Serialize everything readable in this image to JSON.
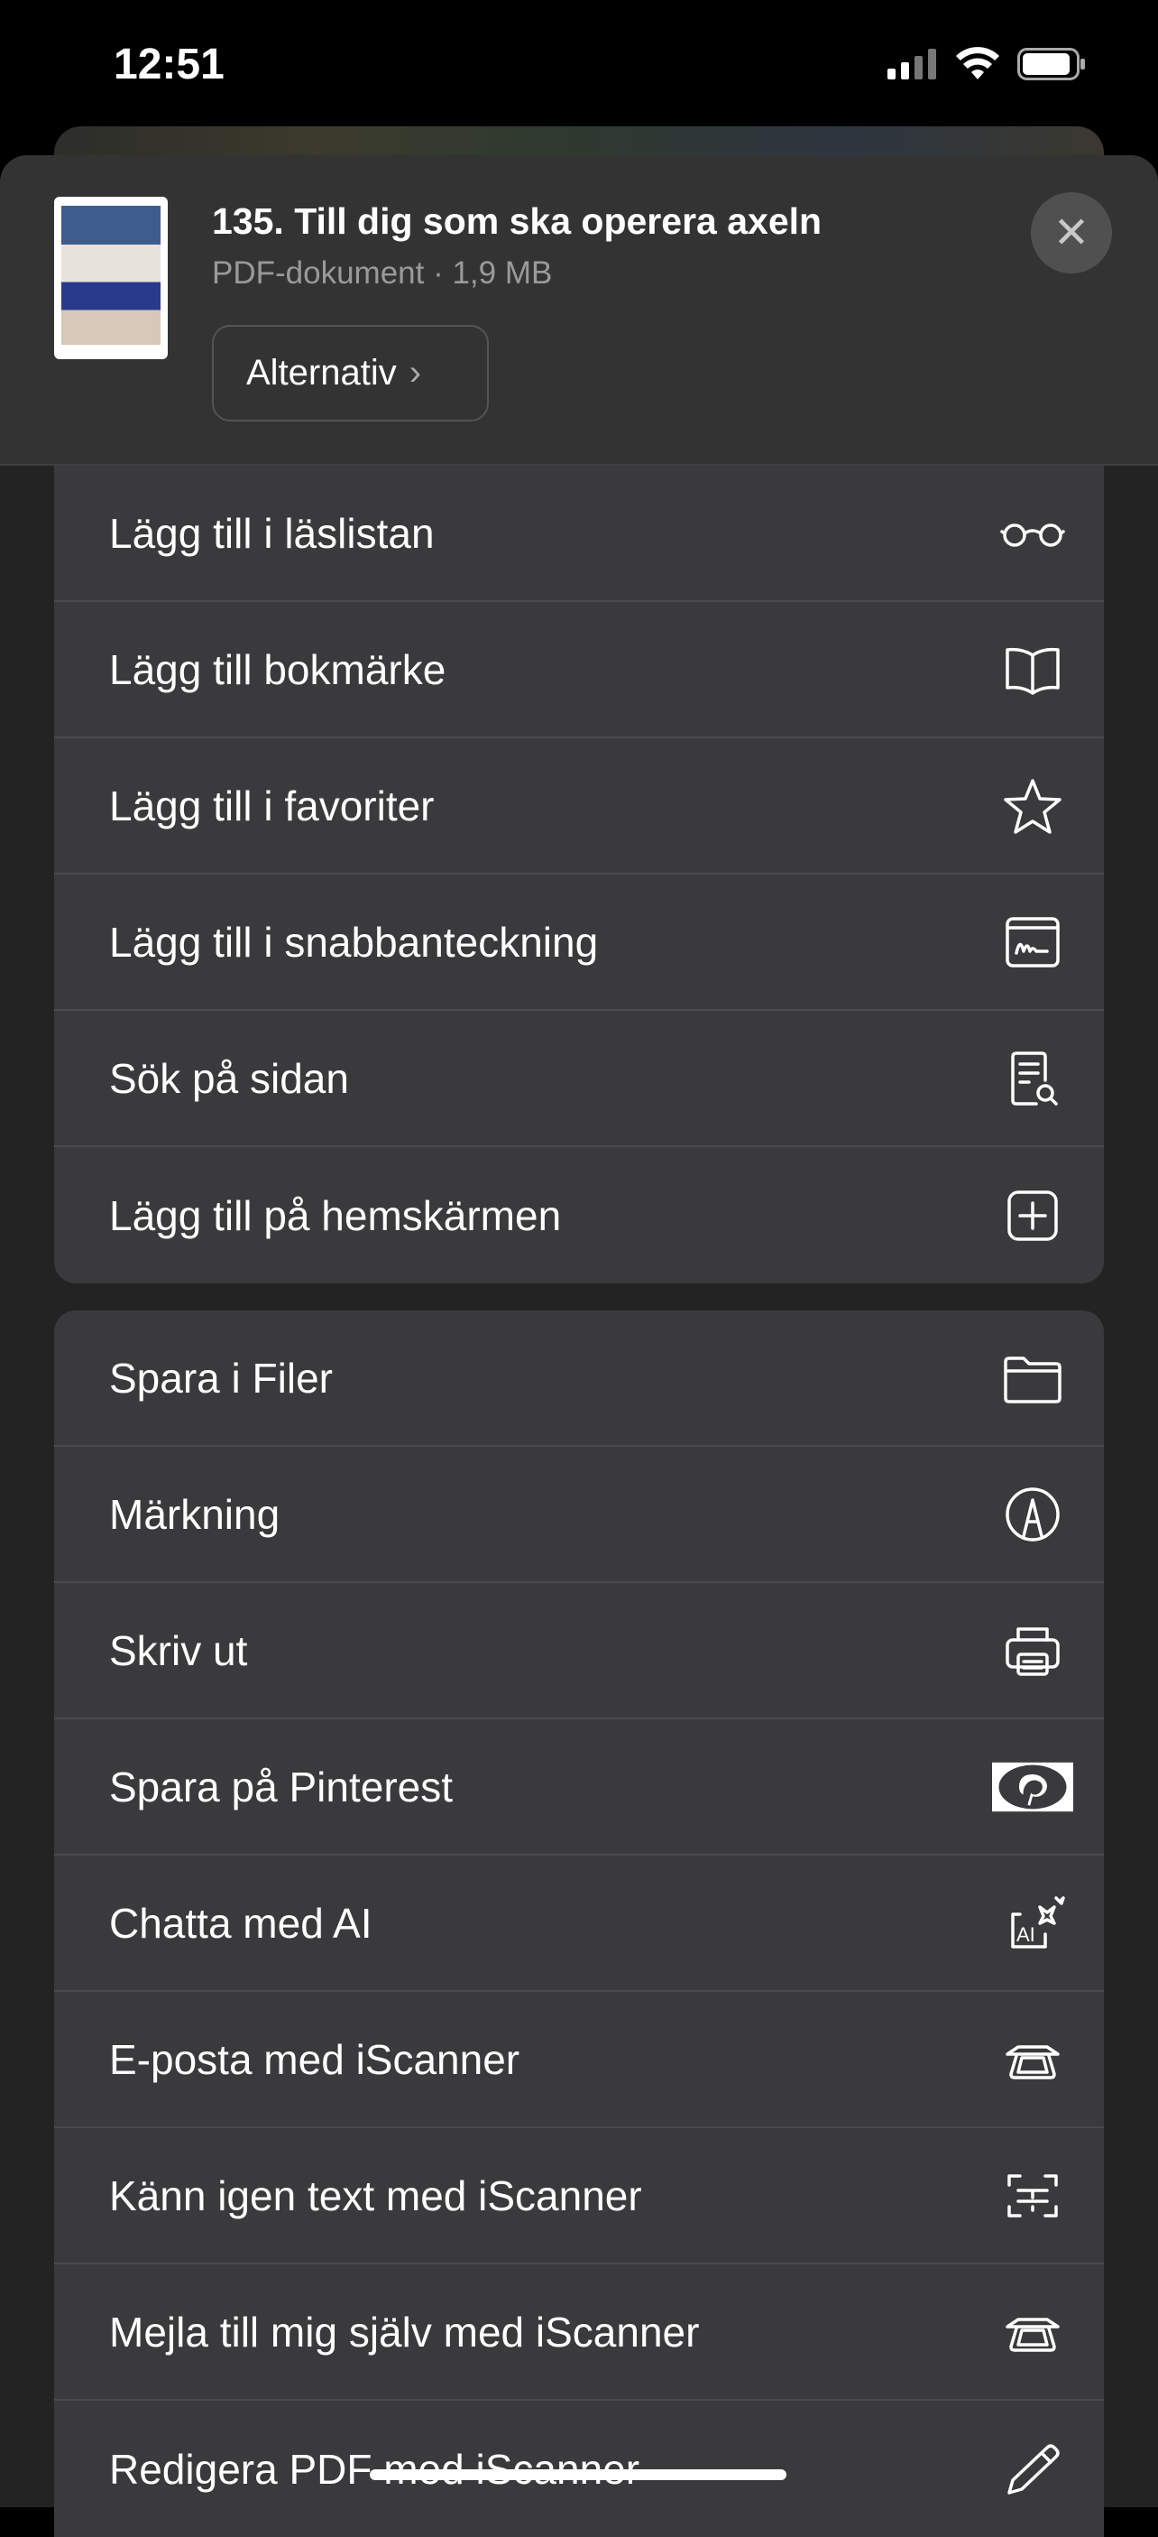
{
  "status_bar": {
    "time": "12:51"
  },
  "header": {
    "title": "135. Till dig som ska operera axeln",
    "subtitle": "PDF-dokument · 1,9 MB",
    "options_label": "Alternativ",
    "options_chevron": "›",
    "close_label": "✕"
  },
  "group1": [
    {
      "label": "Lägg till i läslistan",
      "icon": "glasses-icon"
    },
    {
      "label": "Lägg till bokmärke",
      "icon": "book-icon"
    },
    {
      "label": "Lägg till i favoriter",
      "icon": "star-icon"
    },
    {
      "label": "Lägg till i snabbanteckning",
      "icon": "quick-note-icon"
    },
    {
      "label": "Sök på sidan",
      "icon": "find-in-page-icon"
    },
    {
      "label": "Lägg till på hemskärmen",
      "icon": "add-square-icon"
    }
  ],
  "group2": [
    {
      "label": "Spara i Filer",
      "icon": "folder-icon"
    },
    {
      "label": "Märkning",
      "icon": "markup-icon"
    },
    {
      "label": "Skriv ut",
      "icon": "printer-icon"
    },
    {
      "label": "Spara på Pinterest",
      "icon": "pinterest-icon"
    },
    {
      "label": "Chatta med AI",
      "icon": "ai-icon"
    },
    {
      "label": "E-posta med iScanner",
      "icon": "scanner-icon"
    },
    {
      "label": "Känn igen text med iScanner",
      "icon": "text-scan-icon"
    },
    {
      "label": "Mejla till mig själv med iScanner",
      "icon": "scanner-icon"
    },
    {
      "label": "Redigera PDF med iScanner",
      "icon": "pencil-icon"
    }
  ]
}
